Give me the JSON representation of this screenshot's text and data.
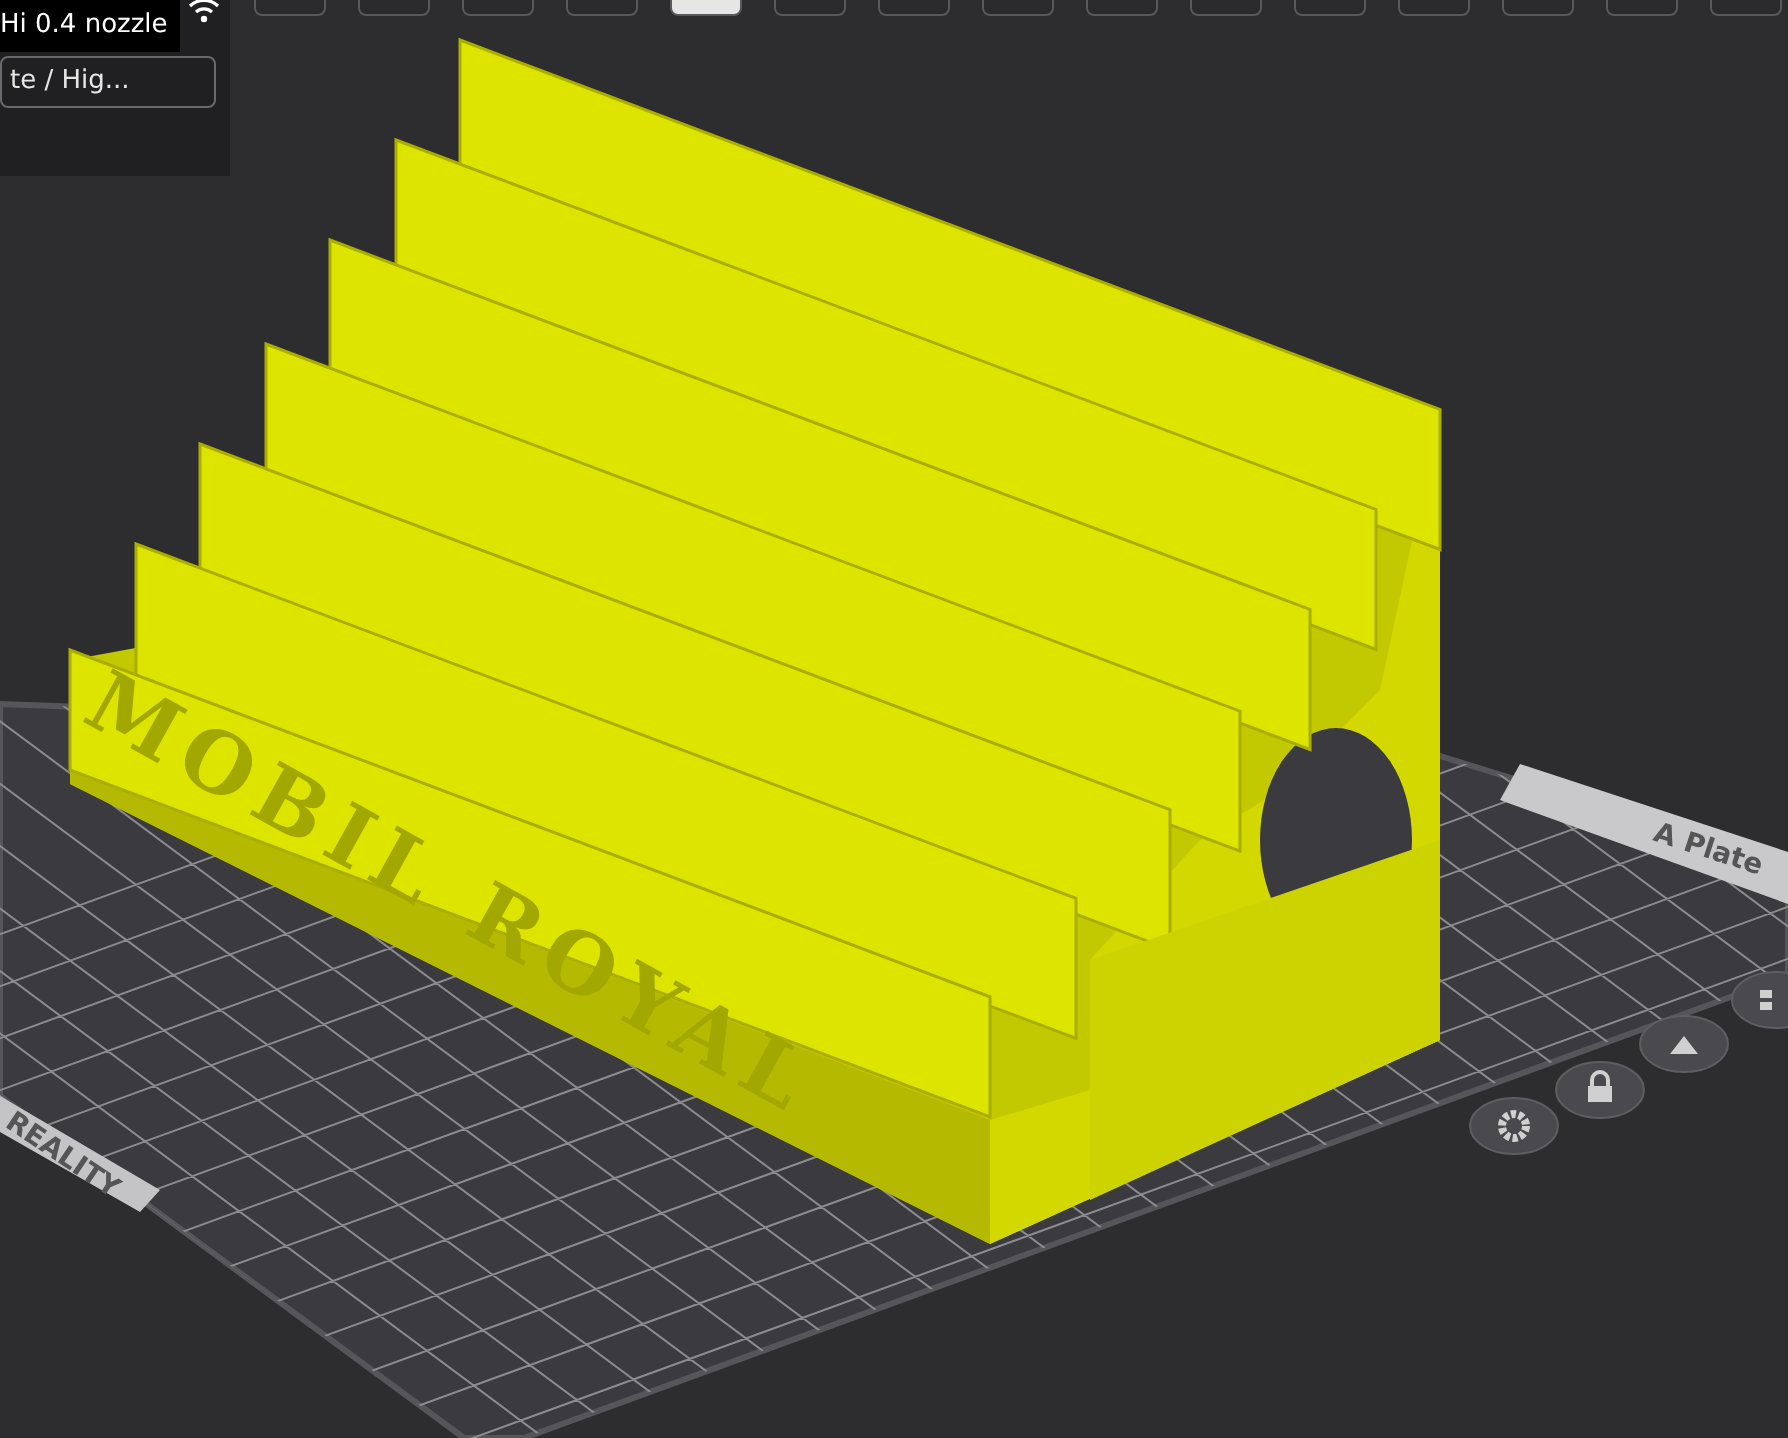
{
  "printer_panel": {
    "tooltip": "Hi 0.4 nozzle",
    "preset_field": {
      "value": "te / Hig..."
    }
  },
  "toolbar": {
    "buttons": [
      {
        "selected": false
      },
      {
        "selected": false
      },
      {
        "selected": false
      },
      {
        "selected": false
      },
      {
        "selected": true
      },
      {
        "selected": false
      },
      {
        "selected": false
      },
      {
        "selected": false
      },
      {
        "selected": false
      },
      {
        "selected": false
      },
      {
        "selected": false
      },
      {
        "selected": false
      },
      {
        "selected": false
      },
      {
        "selected": false
      },
      {
        "selected": false
      }
    ]
  },
  "build_plate": {
    "plate_label": "A Plate",
    "brand_label": "REALITY"
  },
  "model": {
    "embossed_text": "MOBIL ROYAL"
  },
  "plate_buttons": [
    {
      "kind": "settings"
    },
    {
      "kind": "lock"
    },
    {
      "kind": "auto"
    },
    {
      "kind": "arrange"
    }
  ]
}
